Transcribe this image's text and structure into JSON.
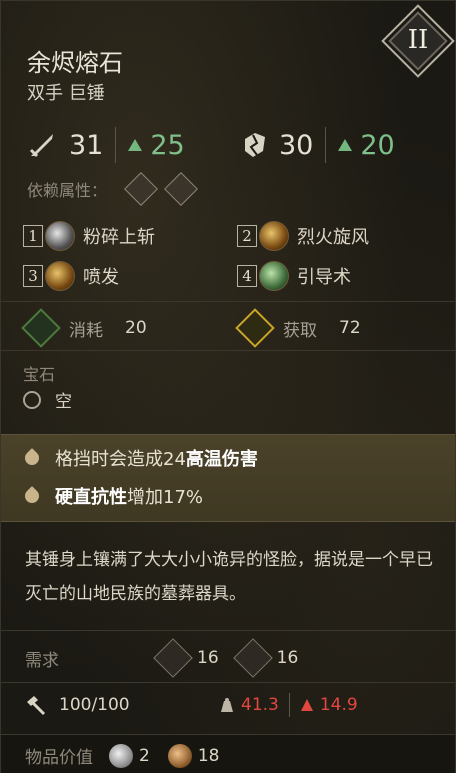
{
  "item": {
    "name": "余烬熔石",
    "type": "双手 巨锤",
    "tier": "II"
  },
  "stats": {
    "attack": {
      "value": "31",
      "bonus": "25"
    },
    "stagger": {
      "value": "30",
      "bonus": "20"
    }
  },
  "dependency": {
    "label": "依赖属性："
  },
  "skills": [
    {
      "num": "1",
      "name": "粉碎上斩"
    },
    {
      "num": "2",
      "name": "烈火旋风"
    },
    {
      "num": "3",
      "name": "喷发"
    },
    {
      "num": "4",
      "name": "引导术"
    }
  ],
  "resources": {
    "consume": {
      "label": "消耗",
      "value": "20"
    },
    "gain": {
      "label": "获取",
      "value": "72"
    }
  },
  "gem": {
    "title": "宝石",
    "slot": "空"
  },
  "perks": [
    {
      "prefix": "格挡时会造成24",
      "bold": "高温伤害",
      "suffix": ""
    },
    {
      "prefix": "",
      "bold": "硬直抗性",
      "suffix": "增加17%"
    }
  ],
  "description": "其锤身上镶满了大大小小诡异的怪脸，据说是一个早已灭亡的山地民族的墓葬器具。",
  "requirements": {
    "label": "需求",
    "strength": "16",
    "intelligence": "16"
  },
  "durability": {
    "value": "100/100",
    "weight": "41.3",
    "equip_load": "14.9"
  },
  "value": {
    "label": "物品价值",
    "silver": "2",
    "copper": "18"
  },
  "colors": {
    "bonus_green": "#7fc08a",
    "warning_red": "#e0483f"
  }
}
